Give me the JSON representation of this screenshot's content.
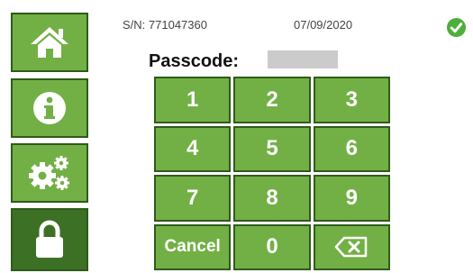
{
  "sidebar": {
    "items": [
      {
        "icon": "home-icon",
        "state": "normal"
      },
      {
        "icon": "info-icon",
        "state": "normal"
      },
      {
        "icon": "gears-icon",
        "state": "normal"
      },
      {
        "icon": "lock-icon",
        "state": "active"
      }
    ]
  },
  "header": {
    "serial": "S/N: 771047360",
    "date": "07/09/2020",
    "status_icon": "check-circle-icon"
  },
  "passcode": {
    "label": "Passcode:",
    "value": ""
  },
  "keypad": {
    "keys": [
      "1",
      "2",
      "3",
      "4",
      "5",
      "6",
      "7",
      "8",
      "9",
      "Cancel",
      "0"
    ],
    "backspace_icon": "backspace-icon"
  },
  "colors": {
    "button": "#72b045",
    "button_active": "#3c7024",
    "border": "#2f5b1a",
    "status_ok": "#4caf3b"
  }
}
